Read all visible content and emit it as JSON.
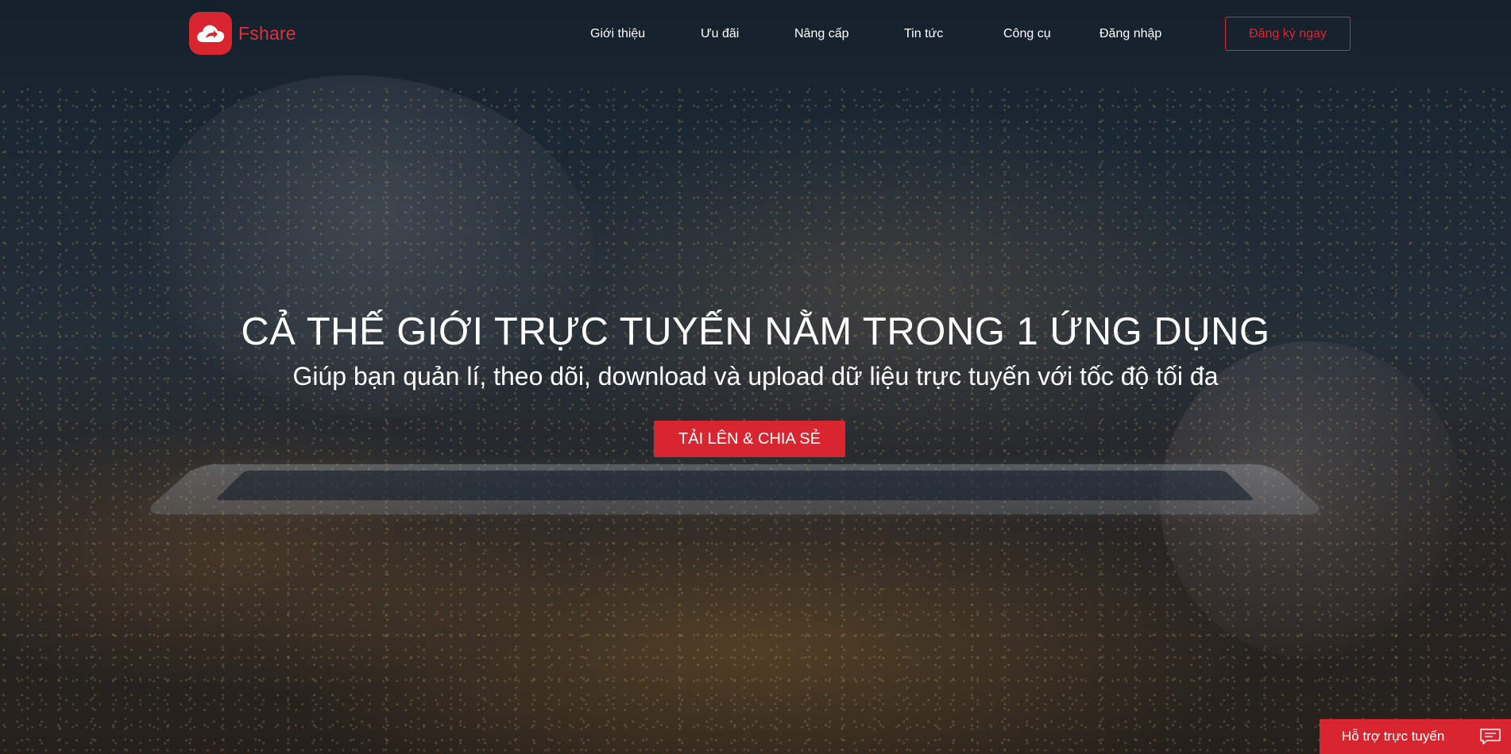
{
  "brand": {
    "name": "Fshare",
    "logo_icon": "cloud-upload-icon",
    "accent_color": "#d9252f"
  },
  "nav": {
    "items": [
      {
        "label": "Giới thiệu"
      },
      {
        "label": "Ưu đãi"
      },
      {
        "label": "Nâng cấp"
      },
      {
        "label": "Tin tức"
      },
      {
        "label": "Công cụ"
      },
      {
        "label": "Đăng nhập"
      }
    ],
    "signup_label": "Đăng ký ngay"
  },
  "hero": {
    "headline": "CẢ THẾ GIỚI TRỰC TUYẾN NẰM TRONG 1 ỨNG DỤNG",
    "subline": "Giúp bạn quản lí, theo dõi, download và upload dữ liệu trực tuyến với tốc độ tối đa",
    "cta_label": "TẢI LÊN & CHIA SẺ"
  },
  "support": {
    "label": "Hỗ trợ trực tuyến",
    "icon": "chat-bubble-icon"
  }
}
